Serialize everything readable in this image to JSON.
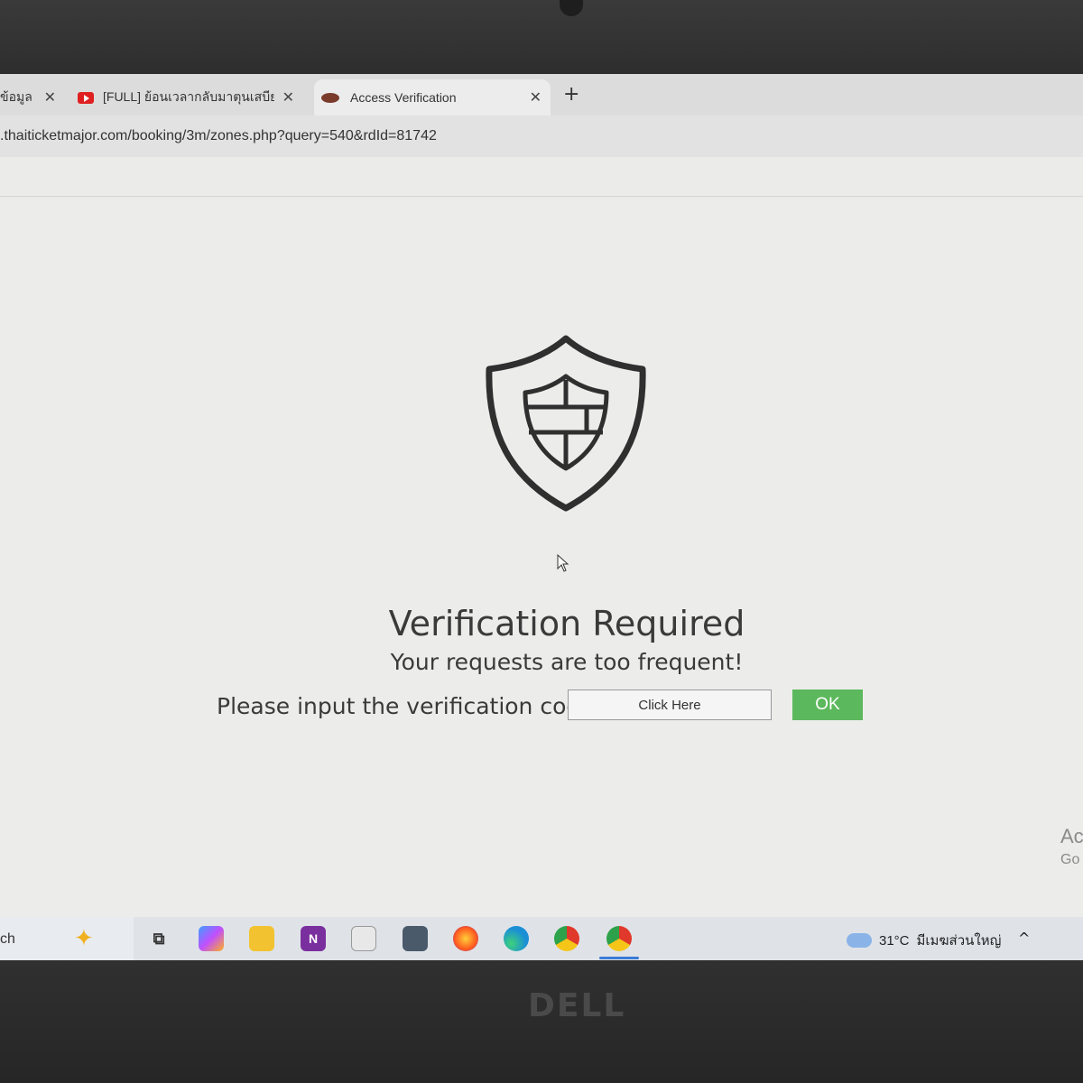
{
  "browser": {
    "tabs": [
      {
        "label": "ข้อมูล"
      },
      {
        "label": "[FULL] ย้อนเวลากลับมาตุนเสบียงก่อน"
      },
      {
        "label": "Access Verification"
      }
    ],
    "close_glyph": "✕",
    "new_tab_glyph": "+",
    "url": ".thaiticketmajor.com/booking/3m/zones.php?query=540&rdId=81742"
  },
  "page": {
    "icon": "shield-wall-icon",
    "title": "Verification Required",
    "subtitle": "Your requests are too frequent!",
    "prompt": "Please input the verification code:",
    "code_field_label": "Click Here",
    "ok_label": "OK",
    "ok_color": "#5cb85c"
  },
  "watermark": {
    "line1": "Ac",
    "line2": "Go"
  },
  "taskbar": {
    "search_text": "ch",
    "apps": [
      "copilot-icon",
      "task-view-icon",
      "microsoft-365-icon",
      "file-explorer-icon",
      "onenote-icon",
      "store-icon",
      "calculator-icon",
      "firefox-icon",
      "edge-icon",
      "chrome-icon",
      "chrome-profile-icon"
    ],
    "weather_temp": "31°C",
    "weather_desc": "มีเมฆส่วนใหญ่",
    "tray_glyph": "^"
  },
  "laptop": {
    "brand": "DELL"
  }
}
